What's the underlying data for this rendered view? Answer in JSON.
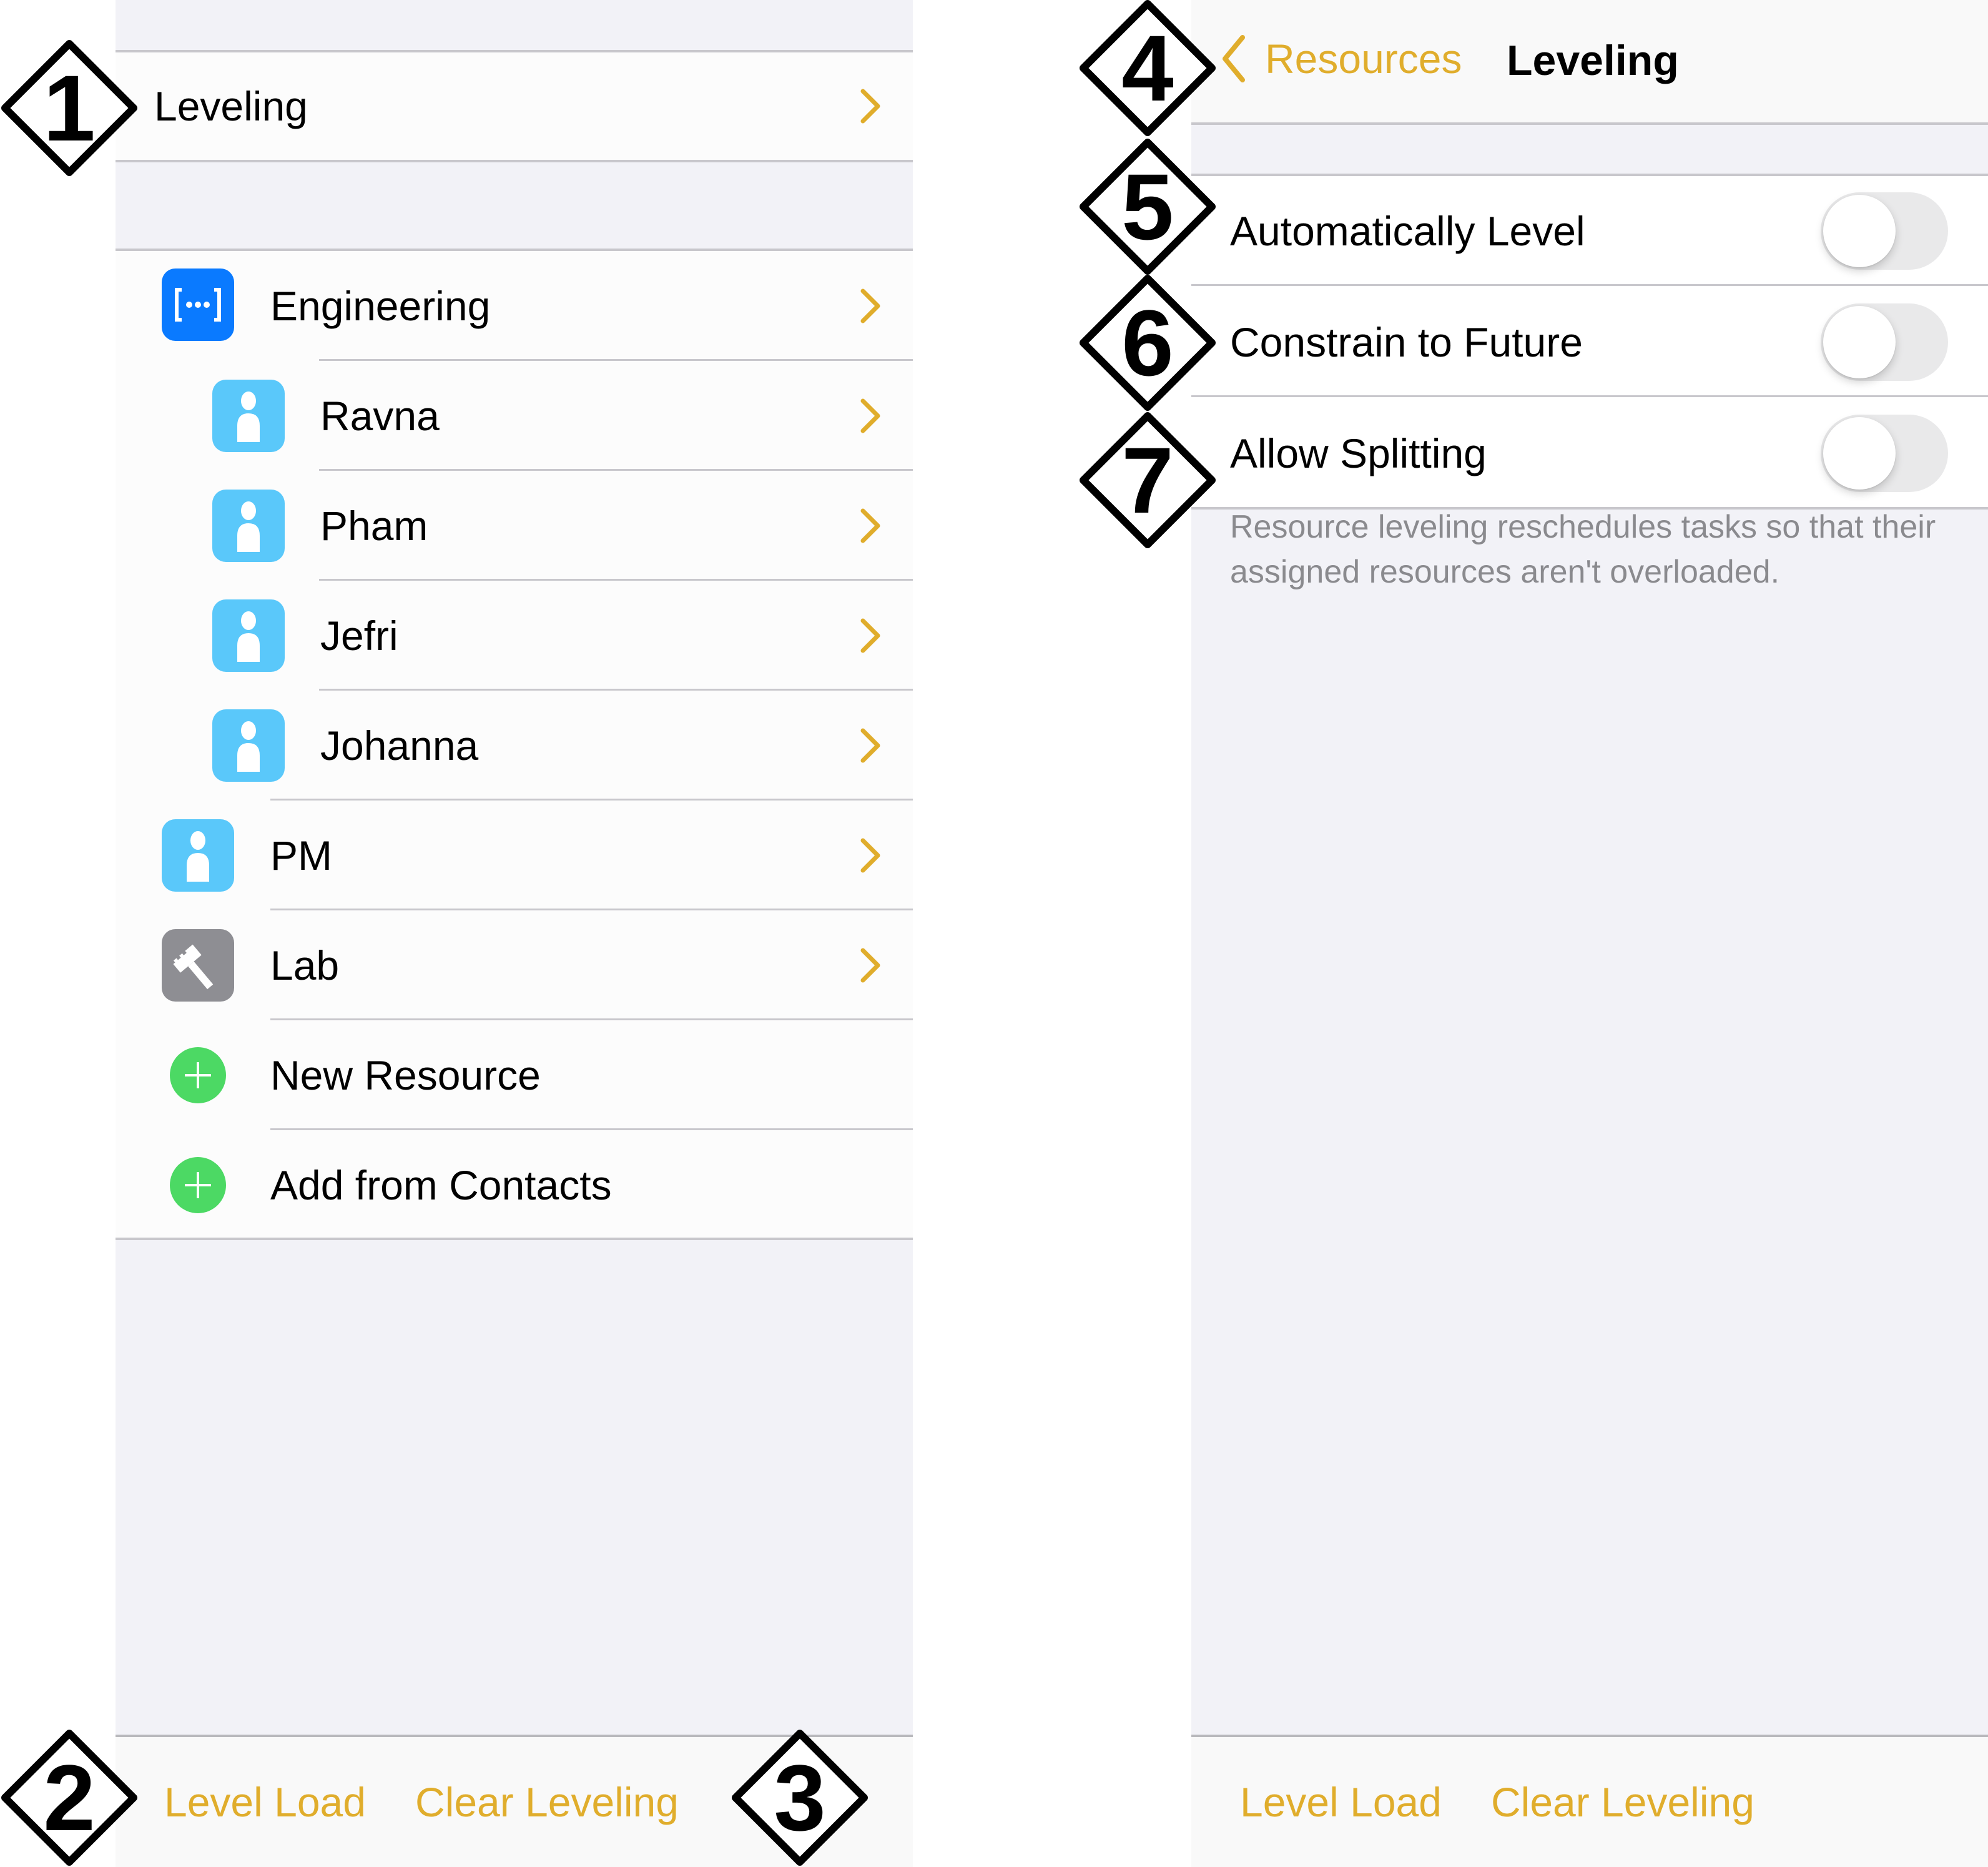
{
  "colors": {
    "accent": "#e0ad2c",
    "group_blue": "#0a7aff",
    "person_blue": "#5ac8fa",
    "equipment_gray": "#8e8e93",
    "add_green": "#4cd964",
    "secondary_text": "#8a8a8e"
  },
  "left_panel": {
    "leveling_row": {
      "label": "Leveling",
      "icon": "chevron-right-icon"
    },
    "resources": [
      {
        "label": "Engineering",
        "icon": "group-icon",
        "level": 0
      },
      {
        "label": "Ravna",
        "icon": "person-icon",
        "level": 1
      },
      {
        "label": "Pham",
        "icon": "person-icon",
        "level": 1
      },
      {
        "label": "Jefri",
        "icon": "person-icon",
        "level": 1
      },
      {
        "label": "Johanna",
        "icon": "person-icon",
        "level": 1
      },
      {
        "label": "PM",
        "icon": "person-icon",
        "level": 0
      },
      {
        "label": "Lab",
        "icon": "hammer-icon",
        "level": 0
      }
    ],
    "actions": [
      {
        "label": "New Resource",
        "icon": "plus-circle-icon"
      },
      {
        "label": "Add from Contacts",
        "icon": "plus-circle-icon"
      }
    ],
    "toolbar": {
      "level_load": "Level Load",
      "clear_leveling": "Clear Leveling"
    }
  },
  "right_panel": {
    "navbar": {
      "back_label": "Resources",
      "title": "Leveling"
    },
    "settings": [
      {
        "label": "Automatically Level",
        "on": false
      },
      {
        "label": "Constrain to Future",
        "on": false
      },
      {
        "label": "Allow Splitting",
        "on": false
      }
    ],
    "footer_note": "Resource leveling reschedules tasks so that their assigned resources aren't overloaded.",
    "toolbar": {
      "level_load": "Level Load",
      "clear_leveling": "Clear Leveling"
    }
  },
  "callouts": [
    "1",
    "2",
    "3",
    "4",
    "5",
    "6",
    "7"
  ]
}
